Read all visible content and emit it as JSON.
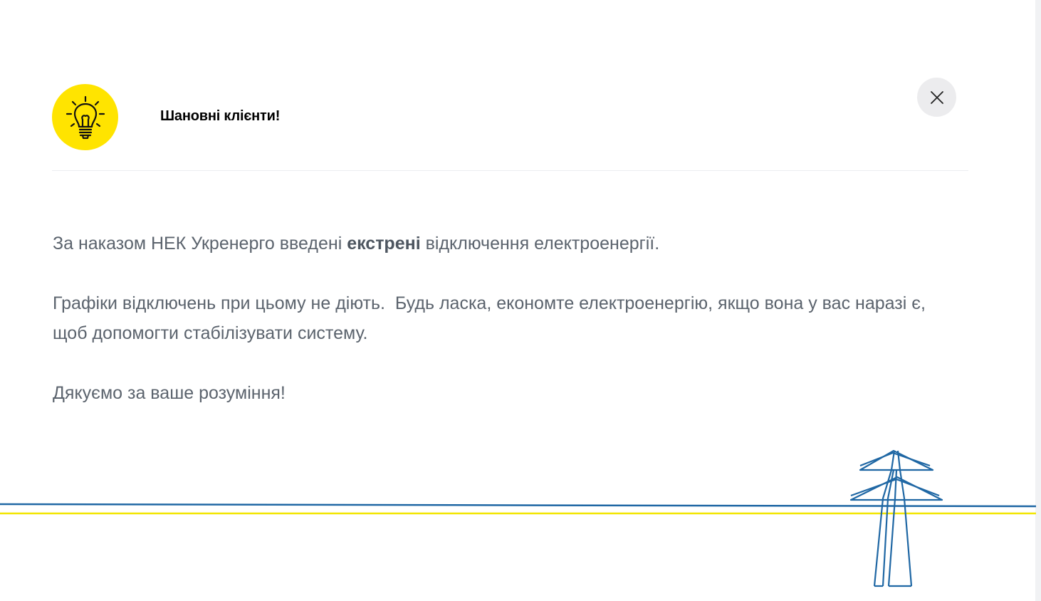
{
  "modal": {
    "title": "Шановні клієнти!",
    "close_label": "Close",
    "body": {
      "line1_before": "За наказом НЕК Укренерго введені ",
      "line1_bold": "екстрені",
      "line1_after": " відключення електроенергії.",
      "paragraph2": "Графіки відключень при цьому не діють.  Будь ласка, економте електроенергію, якщо вона у вас наразі є, щоб допомогти стабілізувати систему.",
      "paragraph3": "Дякуємо за ваше розуміння!"
    }
  },
  "colors": {
    "accent_yellow": "#ffe400",
    "line_blue": "#1f67a4",
    "line_yellow": "#f2e600",
    "text_gray": "#5b636d",
    "title_black": "#000000",
    "close_bg": "#ececee"
  },
  "icons": {
    "badge": "lightbulb-icon",
    "close": "close-icon",
    "decor": "power-pylon-icon"
  }
}
